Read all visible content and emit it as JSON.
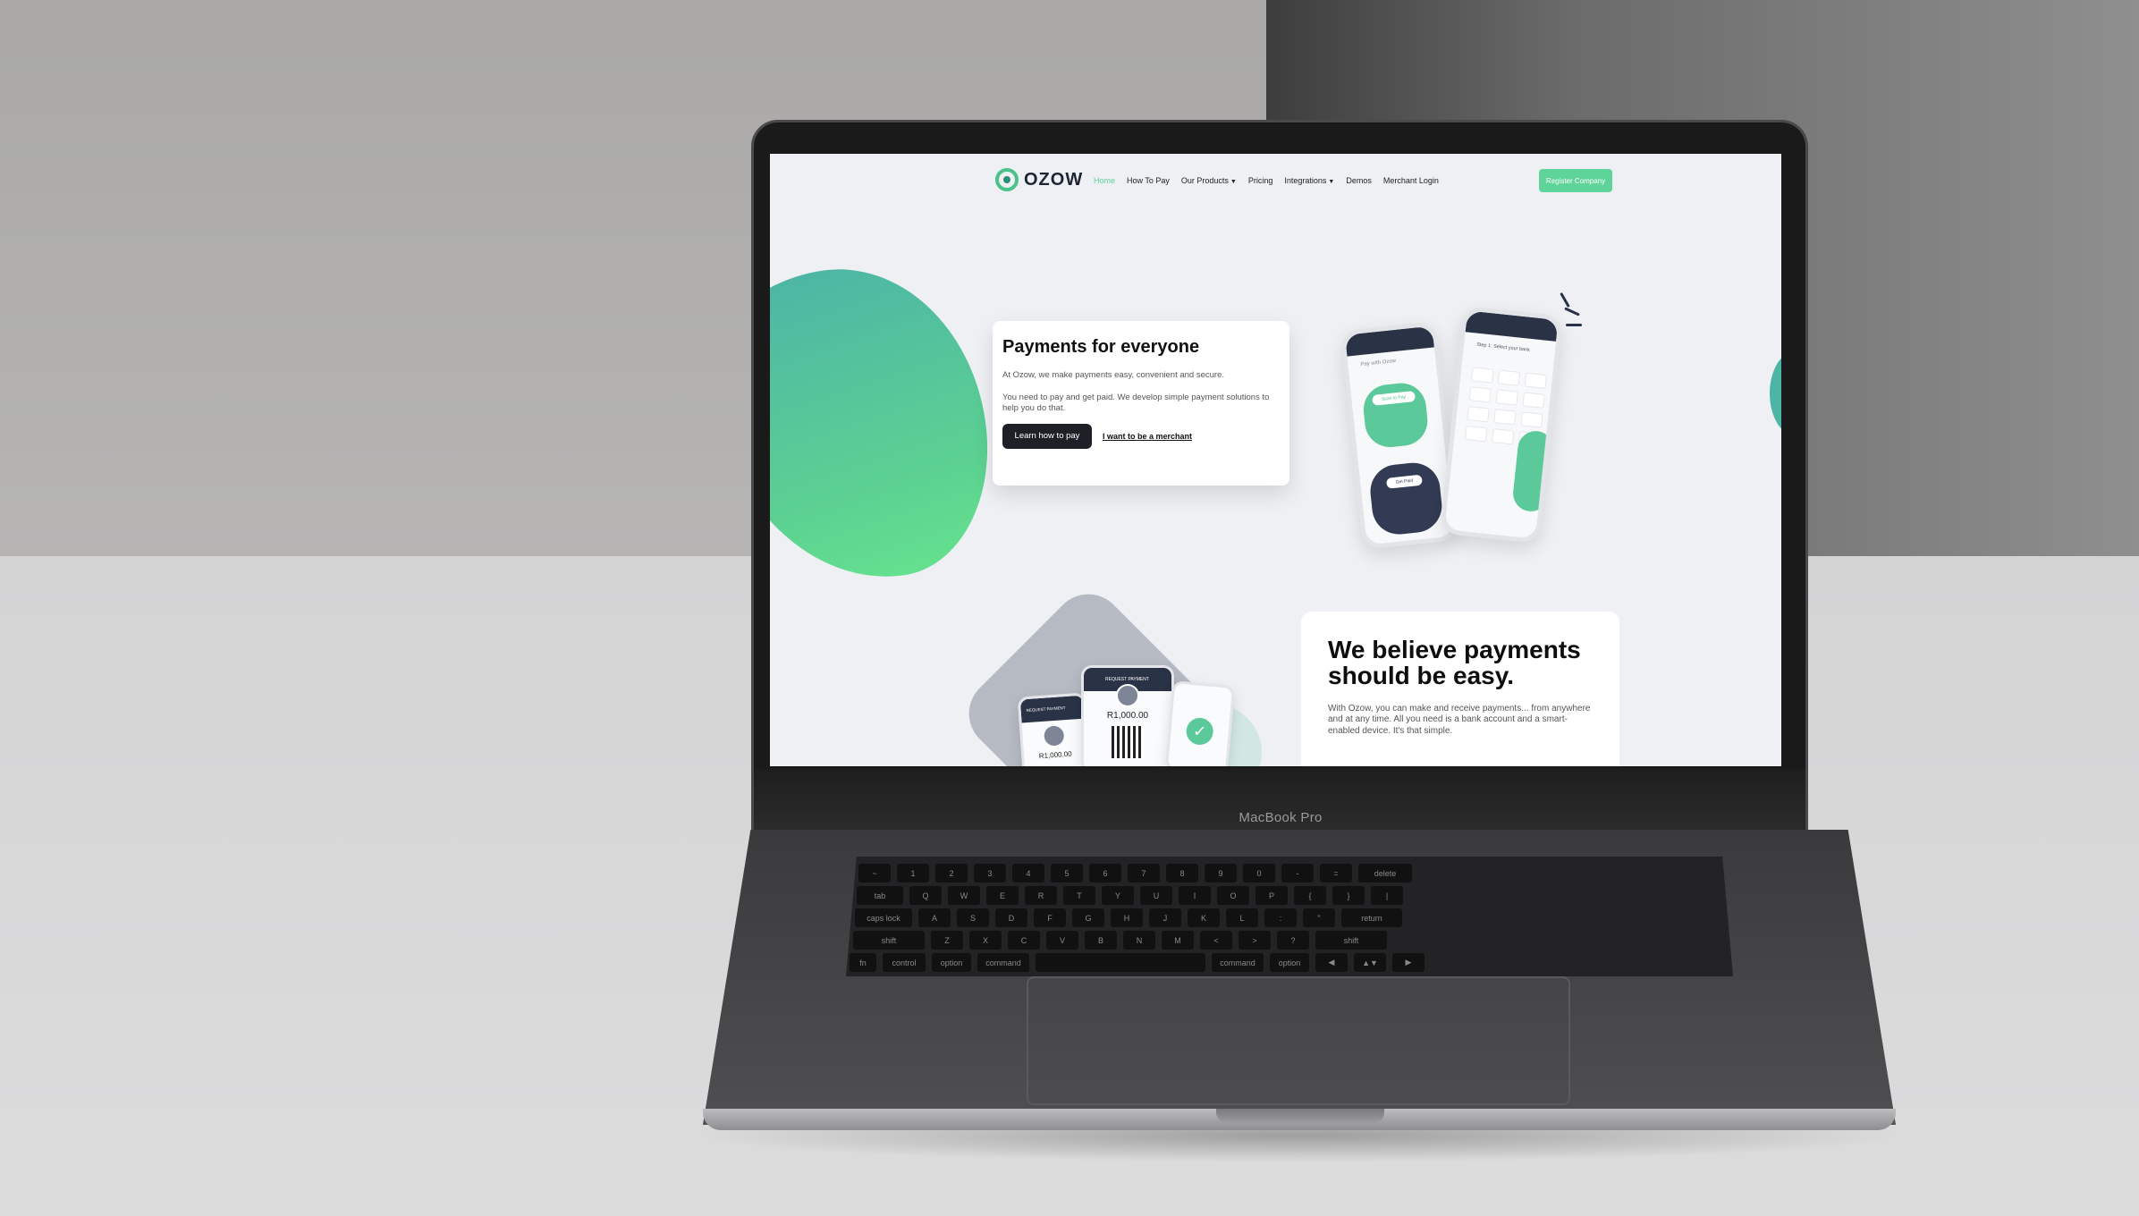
{
  "device": {
    "label": "MacBook Pro"
  },
  "nav": {
    "brand": "OZOW",
    "links": [
      {
        "label": "Home",
        "active": true
      },
      {
        "label": "How To Pay",
        "active": false
      },
      {
        "label": "Our Products",
        "active": false,
        "dropdown": true
      },
      {
        "label": "Pricing",
        "active": false
      },
      {
        "label": "Integrations",
        "active": false,
        "dropdown": true
      },
      {
        "label": "Demos",
        "active": false
      },
      {
        "label": "Merchant Login",
        "active": false
      }
    ],
    "cta": "Register Company"
  },
  "hero": {
    "title": "Payments for everyone",
    "paragraph1": "At Ozow, we make payments easy, convenient and secure.",
    "paragraph2": "You need to pay and get paid. We develop simple payment solutions to help you do that.",
    "primary_button": "Learn how to pay",
    "secondary_link": "I want to be a merchant"
  },
  "mockup": {
    "phone_a": {
      "heading": "Pay with Ozow",
      "pill_top": "Scan to Pay",
      "pill_bottom": "Get Paid"
    },
    "phone_b": {
      "heading": "Step 1: Select your bank"
    }
  },
  "belief": {
    "title": "We believe payments should be easy.",
    "text": "With Ozow, you can make and receive payments... from anywhere and at any time. All you need is a bank account and a smart-enabled device. It's that simple."
  },
  "lower_mockup": {
    "label": "REQUEST PAYMENT",
    "amount": "R1,000.00",
    "amount2": "R1,000.00"
  },
  "colors": {
    "accent": "#5fd49a",
    "navy": "#1d2027",
    "teal": "#4db4a6"
  },
  "keyboard": {
    "row1": [
      "~",
      "1",
      "2",
      "3",
      "4",
      "5",
      "6",
      "7",
      "8",
      "9",
      "0",
      "-",
      "=",
      "delete"
    ],
    "row2": [
      "tab",
      "Q",
      "W",
      "E",
      "R",
      "T",
      "Y",
      "U",
      "I",
      "O",
      "P",
      "{",
      "}",
      "|"
    ],
    "row3": [
      "caps lock",
      "A",
      "S",
      "D",
      "F",
      "G",
      "H",
      "J",
      "K",
      "L",
      ":",
      "\"",
      "return"
    ],
    "row4": [
      "shift",
      "Z",
      "X",
      "C",
      "V",
      "B",
      "N",
      "M",
      "<",
      ">",
      "?",
      "shift"
    ],
    "row5": [
      "fn",
      "control",
      "option",
      "command",
      "",
      "command",
      "option",
      "◀",
      "▲▼",
      "▶"
    ]
  }
}
